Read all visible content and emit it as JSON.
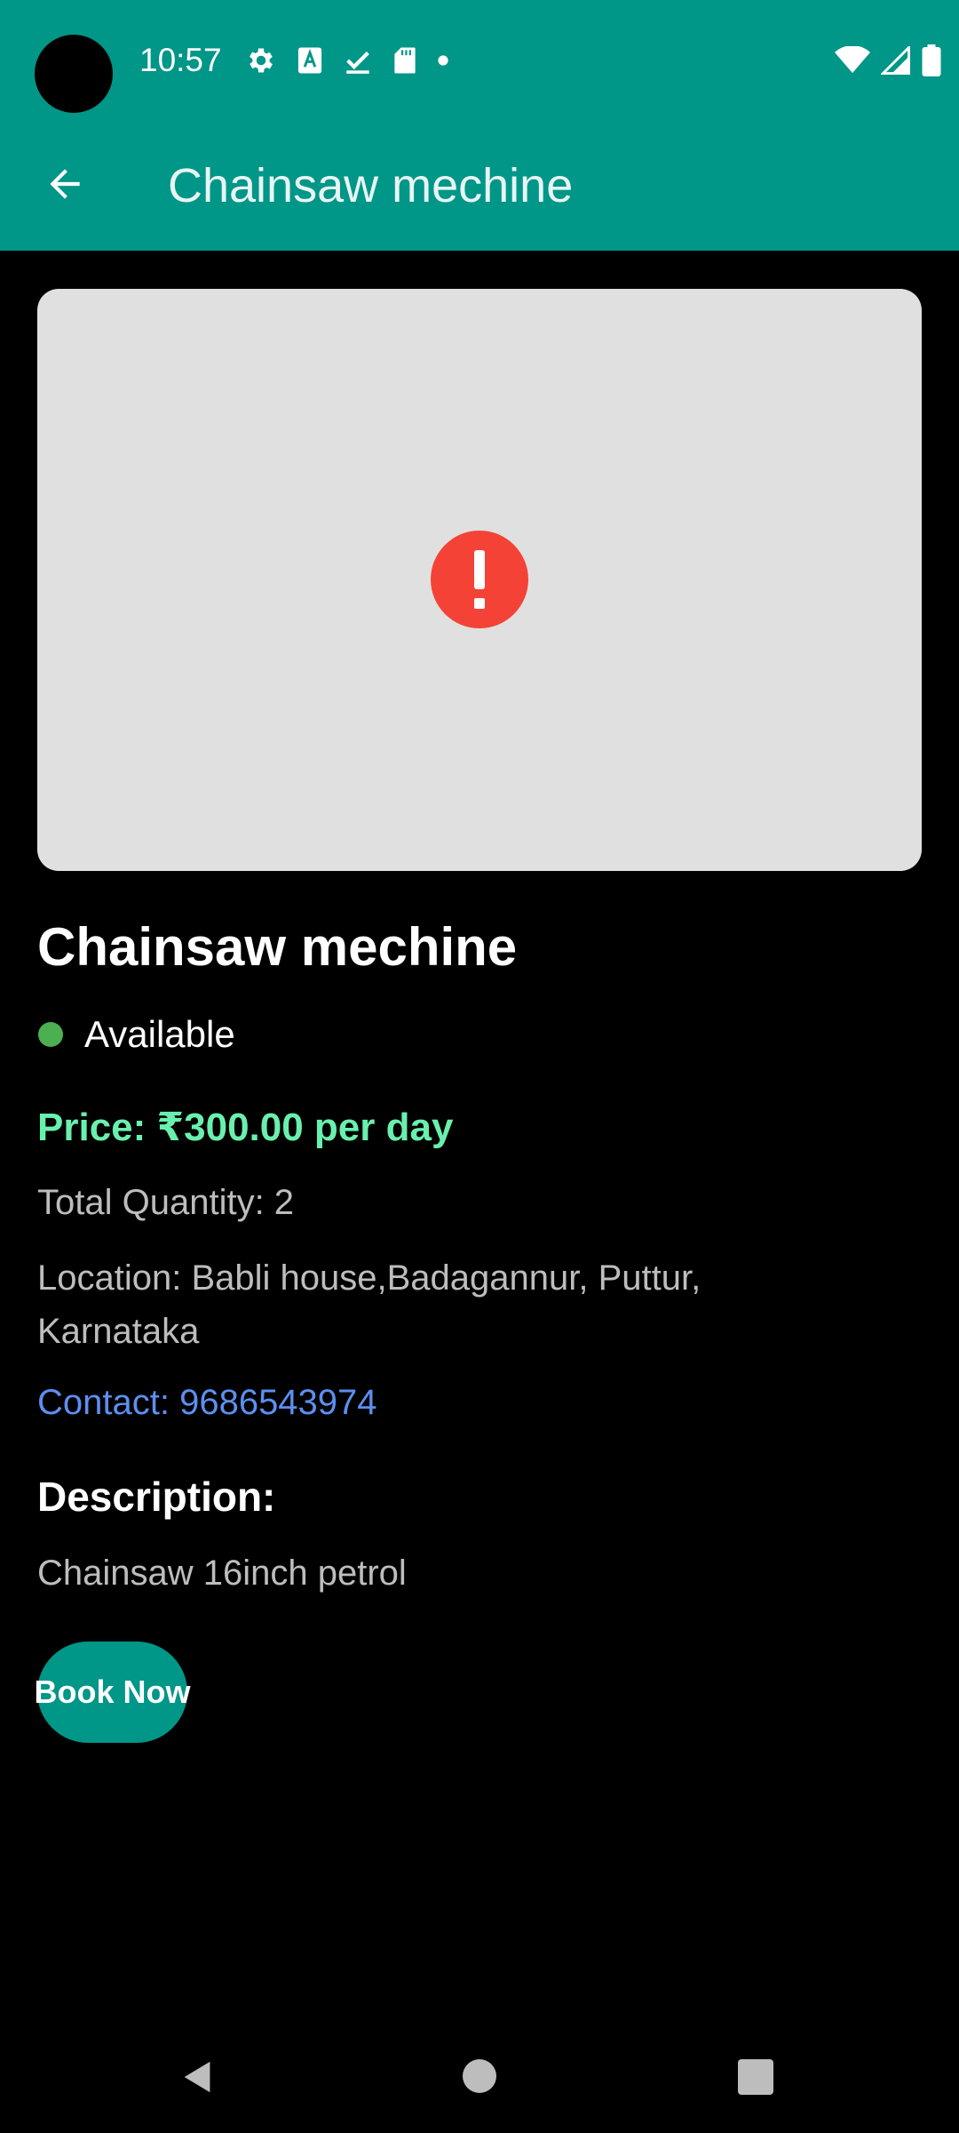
{
  "status_bar": {
    "time": "10:57",
    "icons_left": [
      "settings-icon",
      "font-a-icon",
      "checkmark-download-icon",
      "sd-card-icon",
      "notification-dot-icon"
    ],
    "icons_right": [
      "wifi-icon",
      "cell-signal-icon",
      "battery-icon"
    ]
  },
  "app_bar": {
    "title": "Chainsaw mechine",
    "back_icon": "arrow-back-icon",
    "color": "#009688"
  },
  "item": {
    "image_state_icon": "error-icon",
    "image_error_color": "#f44336",
    "title": "Chainsaw mechine",
    "availability": "Available",
    "availability_color": "#4caf50",
    "price": "Price: ₹300.00 per day",
    "price_color": "#69f0ae",
    "quantity": "Total Quantity: 2",
    "location": "Location: Babli house,Badagannur, Puttur, Karnataka",
    "contact": "Contact: 9686543974",
    "contact_color": "#5c8ff0",
    "description_heading": "Description:",
    "description": "Chainsaw 16inch petrol"
  },
  "actions": {
    "book_label": "Book Now"
  },
  "nav_bar": {
    "back_icon": "nav-back-icon",
    "home_icon": "nav-home-icon",
    "recents_icon": "nav-recents-icon"
  }
}
